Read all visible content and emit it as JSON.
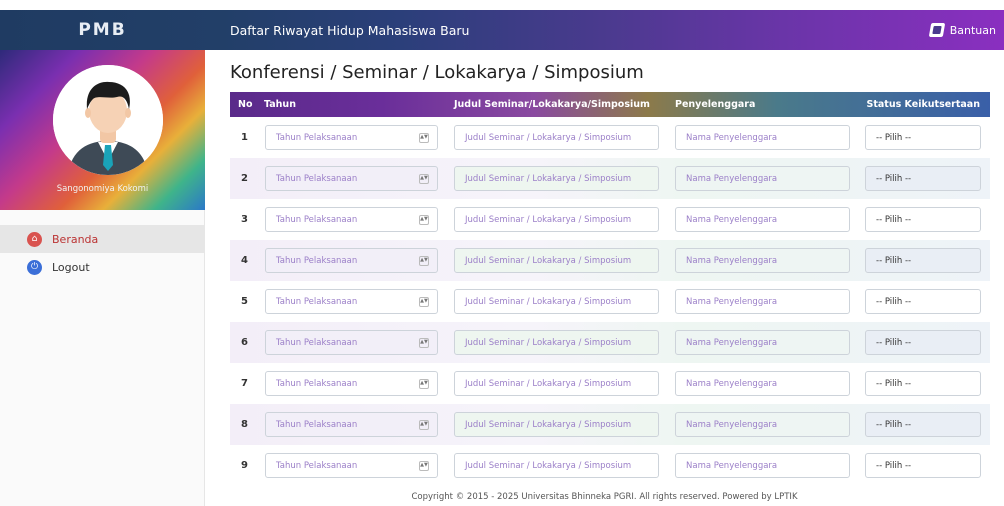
{
  "header": {
    "brand": "PMB",
    "app_title": "Daftar Riwayat Hidup Mahasiswa Baru",
    "help_label": "Bantuan",
    "help_icon": "book-icon"
  },
  "sidebar": {
    "user_name": "Sangonomiya Kokomi",
    "items": [
      {
        "label": "Beranda",
        "icon": "home-icon",
        "active": true
      },
      {
        "label": "Logout",
        "icon": "power-icon",
        "active": false
      }
    ]
  },
  "main": {
    "title": "Konferensi / Seminar / Lokakarya / Simposium",
    "columns": [
      "No",
      "Tahun",
      "Judul Seminar/Lokakarya/Simposium",
      "Penyelenggara",
      "Status Keikutsertaan"
    ],
    "placeholders": {
      "tahun": "Tahun Pelaksanaan",
      "judul": "Judul Seminar / Lokakarya / Simposium",
      "penyelenggara": "Nama Penyelenggara",
      "status": "-- Pilih --"
    },
    "rows": [
      "1",
      "2",
      "3",
      "4",
      "5",
      "6",
      "7",
      "8",
      "9"
    ]
  },
  "footer": {
    "text": "Copyright © 2015 - 2025 Universitas Bhinneka PGRI. All rights reserved. Powered by LPTIK"
  },
  "colors": {
    "header_start": "#1f3b62",
    "header_end": "#8a2fc0",
    "active_nav": "#d9534f",
    "logout_icon": "#3b6fd8"
  }
}
